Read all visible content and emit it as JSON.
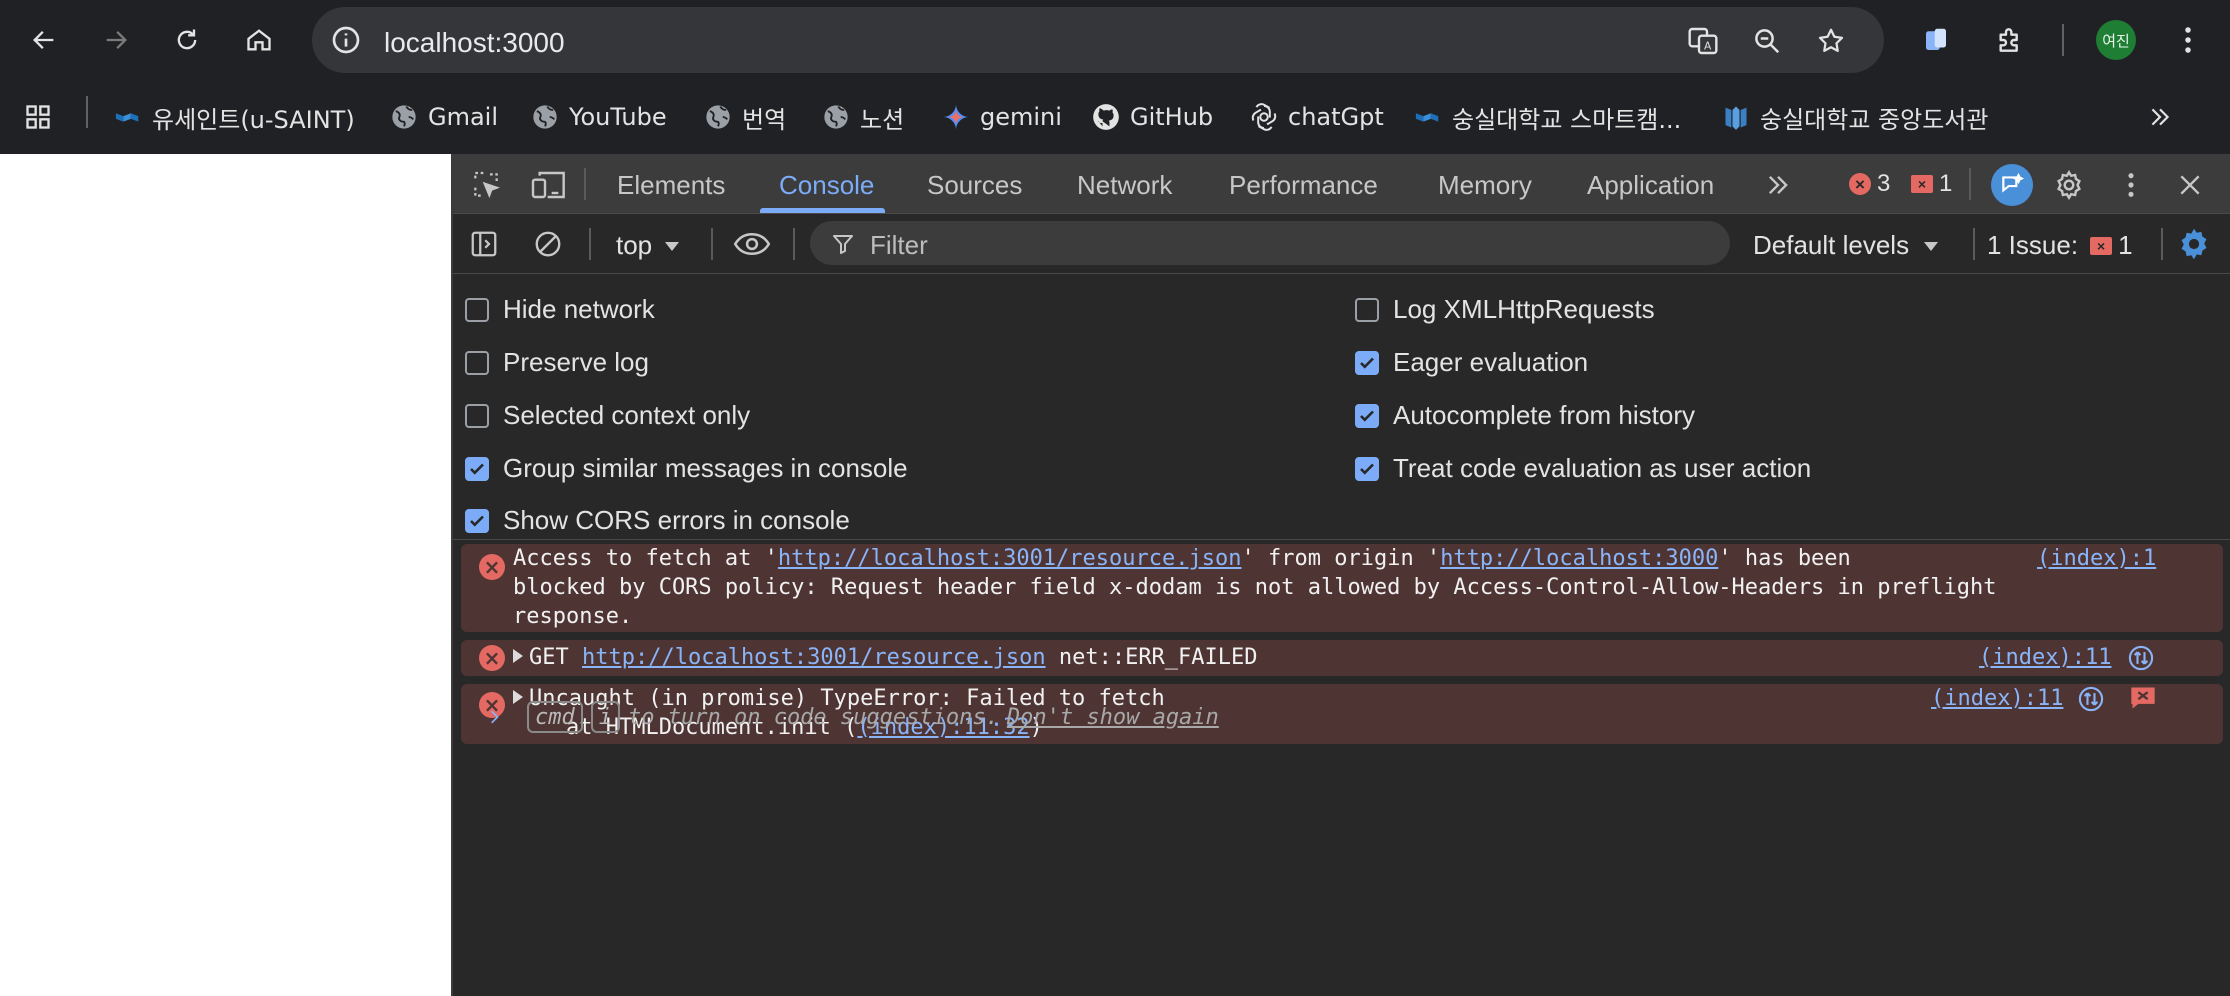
{
  "browser": {
    "url": "localhost:3000",
    "profile_initials": "여진"
  },
  "bookmarks": [
    {
      "label": "유세인트(u-SAINT)",
      "icon": "ssu-logo-icon"
    },
    {
      "label": "Gmail",
      "icon": "globe-icon"
    },
    {
      "label": "YouTube",
      "icon": "globe-icon"
    },
    {
      "label": "번역",
      "icon": "globe-icon"
    },
    {
      "label": "노션",
      "icon": "globe-icon"
    },
    {
      "label": "gemini",
      "icon": "gemini-sparkle-icon"
    },
    {
      "label": "GitHub",
      "icon": "github-icon"
    },
    {
      "label": "chatGpt",
      "icon": "openai-icon"
    },
    {
      "label": "숭실대학교 스마트캠...",
      "icon": "ssu-logo-icon"
    },
    {
      "label": "숭실대학교 중앙도서관",
      "icon": "library-logo-icon"
    }
  ],
  "devtools": {
    "tabs": [
      "Elements",
      "Console",
      "Sources",
      "Network",
      "Performance",
      "Memory",
      "Application"
    ],
    "active_tab": "Console",
    "error_count": "3",
    "issue_count": "1",
    "context": "top",
    "filter_placeholder": "Filter",
    "levels": "Default levels",
    "issues_label": "1 Issue:",
    "issues_badge": "1",
    "accent": "#7cacf8",
    "error_color": "#e46962"
  },
  "settings": {
    "left": [
      {
        "label": "Hide network",
        "checked": false
      },
      {
        "label": "Preserve log",
        "checked": false
      },
      {
        "label": "Selected context only",
        "checked": false
      },
      {
        "label": "Group similar messages in console",
        "checked": true
      },
      {
        "label": "Show CORS errors in console",
        "checked": true
      }
    ],
    "right": [
      {
        "label": "Log XMLHttpRequests",
        "checked": false
      },
      {
        "label": "Eager evaluation",
        "checked": true
      },
      {
        "label": "Autocomplete from history",
        "checked": true
      },
      {
        "label": "Treat code evaluation as user action",
        "checked": true
      }
    ]
  },
  "messages": [
    {
      "line1_pre": "Access to fetch at '",
      "line1_link1": "http://localhost:3001/resource.json",
      "line1_mid": "' from origin '",
      "line1_link2": "http://localhost:3000",
      "line1_post": "' has been",
      "line2": "blocked by CORS policy: Request header field x-dodam is not allowed by Access-Control-Allow-Headers in preflight",
      "line3": "response.",
      "source": "(index):1"
    },
    {
      "method": "GET",
      "url": "http://localhost:3001/resource.json",
      "status": "net::ERR_FAILED",
      "source": "(index):11"
    },
    {
      "line1": "Uncaught (in promise) TypeError: Failed to fetch",
      "line2_pre": "    at HTMLDocument.init (",
      "line2_link": "(index):11:32",
      "line2_post": ")",
      "source": "(index):11"
    }
  ],
  "prompt": {
    "key1": "cmd",
    "key2": "i",
    "text": "to turn on code suggestions.",
    "dismiss": "Don't show again"
  }
}
